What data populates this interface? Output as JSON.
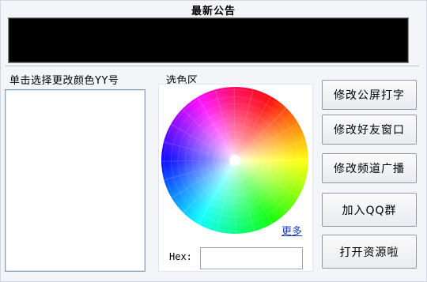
{
  "window": {
    "notice_title": "最新公告",
    "notice_text": "",
    "list_label": "单击选择更改颜色YY号",
    "color_area_label": "选色区",
    "more_link": "更多",
    "hex_label": "Hex:",
    "hex_value": ""
  },
  "buttons": [
    {
      "label": "修改公屏打字"
    },
    {
      "label": "修改好友窗口"
    },
    {
      "label": "修改频道广播"
    },
    {
      "label": "加入QQ群"
    },
    {
      "label": "打开资源啦"
    }
  ],
  "colors": {
    "notice_background": "#000000",
    "link": "#1a3fb3",
    "list_border": "#7f9db9"
  },
  "icons": [
    "color-wheel"
  ]
}
